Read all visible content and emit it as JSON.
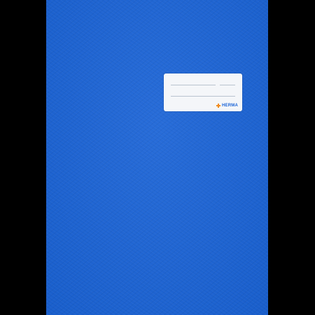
{
  "product": {
    "brand": "HERMA",
    "cover_color": "#1a63d6",
    "label_color": "#f4f6f9",
    "brand_mark_color": "#f28c1e",
    "background_color": "#000000"
  },
  "icons": {
    "brand_mark": "herma-flower-logo-icon"
  }
}
